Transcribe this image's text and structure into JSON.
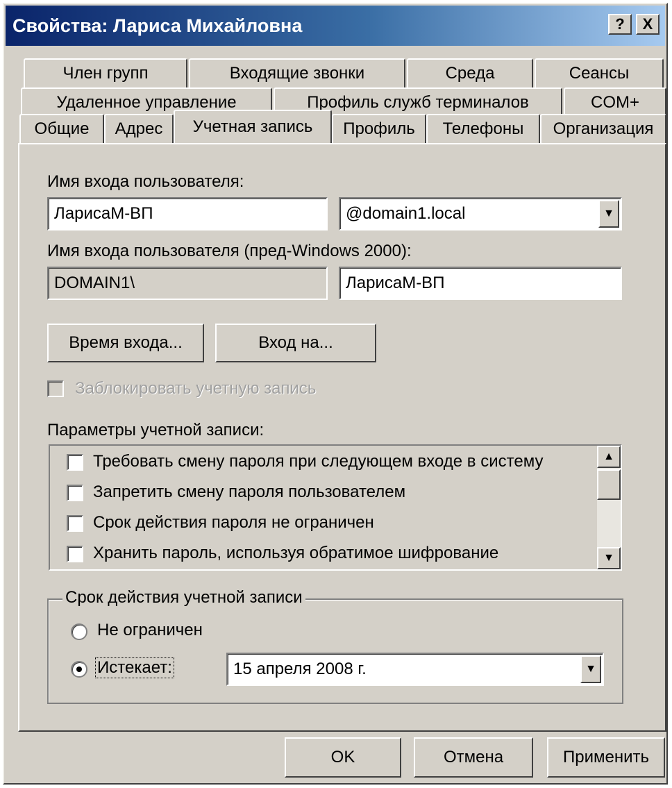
{
  "title": "Свойства: Лариса Михайловна",
  "titlebar_buttons": {
    "help": "?",
    "close": "X"
  },
  "tabs": {
    "row1": [
      "Член групп",
      "Входящие звонки",
      "Среда",
      "Сеансы"
    ],
    "row2": [
      "Удаленное управление",
      "Профиль служб терминалов",
      "COM+"
    ],
    "row3": [
      "Общие",
      "Адрес",
      "Учетная запись",
      "Профиль",
      "Телефоны",
      "Организация"
    ],
    "active": "Учетная запись"
  },
  "account": {
    "logon_label": "Имя входа пользователя:",
    "logon_value": "ЛарисаМ-ВП",
    "domain_value": "@domain1.local",
    "pre2000_label": "Имя входа пользователя (пред-Windows 2000):",
    "pre2000_domain": "DOMAIN1\\",
    "pre2000_value": "ЛарисаМ-ВП",
    "logon_hours_button": "Время входа...",
    "logon_to_button": "Вход на...",
    "lock_checkbox": "Заблокировать учетную запись",
    "options_label": "Параметры учетной записи:",
    "options": [
      "Требовать смену пароля при следующем входе в систему",
      "Запретить смену пароля пользователем",
      "Срок действия пароля не ограничен",
      "Хранить пароль, используя обратимое шифрование"
    ],
    "expiry_group": "Срок действия учетной записи",
    "never_label": "Не ограничен",
    "expires_label": "Истекает:",
    "expires_date": "15  апреля  2008 г.",
    "selected_expiry": "expires"
  },
  "footer": {
    "ok": "OK",
    "cancel": "Отмена",
    "apply": "Применить"
  }
}
